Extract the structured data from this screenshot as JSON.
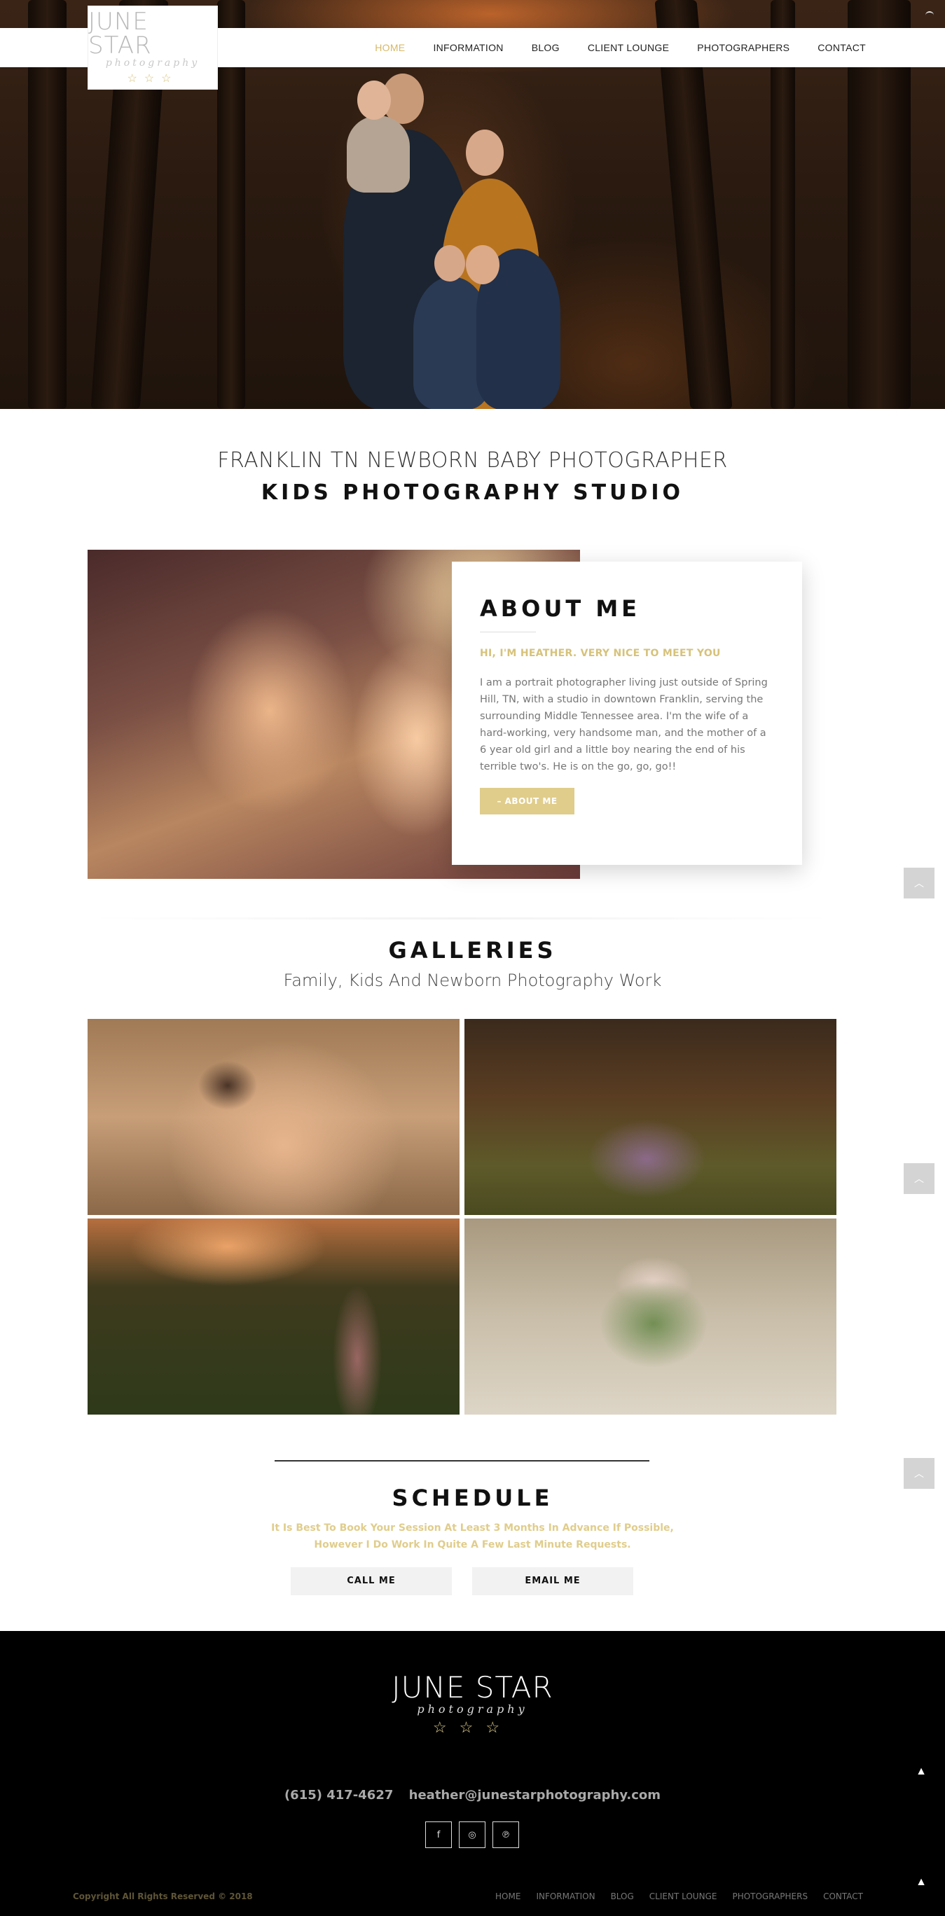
{
  "site": {
    "logo_main": "JUNE STAR",
    "logo_sub": "photography",
    "logo_stars": "☆☆☆"
  },
  "nav": {
    "items": [
      {
        "label": "HOME",
        "active": true
      },
      {
        "label": "INFORMATION"
      },
      {
        "label": "BLOG"
      },
      {
        "label": "CLIENT LOUNGE"
      },
      {
        "label": "PHOTOGRAPHERS"
      },
      {
        "label": "CONTACT"
      }
    ]
  },
  "intro": {
    "line1": "FRANKLIN TN NEWBORN BABY PHOTOGRAPHER",
    "line2": "KIDS PHOTOGRAPHY STUDIO"
  },
  "about": {
    "title": "ABOUT ME",
    "subtitle": "HI, I'M HEATHER. VERY NICE TO MEET YOU",
    "text": "I am a portrait photographer living just outside of Spring Hill, TN, with a studio in downtown Franklin, serving the surrounding Middle Tennessee area. I'm the wife of a hard-working, very handsome man, and the mother of a 6 year old girl and a little boy nearing the end of his terrible two's. He is on the go, go, go!!",
    "button": "– ABOUT ME"
  },
  "galleries": {
    "title": "GALLERIES",
    "subtitle": "Family, Kids And Newborn Photography Work"
  },
  "schedule": {
    "title": "SCHEDULE",
    "note_line1": "It Is Best To Book Your Session At Least 3 Months In Advance If Possible,",
    "note_line2": "However I Do Work In Quite A Few Last Minute Requests.",
    "call_button": "CALL ME",
    "email_button": "EMAIL ME"
  },
  "footer": {
    "logo_main": "JUNE STAR",
    "logo_sub": "photography",
    "logo_stars": "☆☆☆",
    "phone": "(615) 417-4627",
    "email": "heather@junestarphotography.com",
    "social": [
      "f",
      "◎",
      "℗"
    ],
    "copyright": "Copyright All Rights Reserved © 2018",
    "nav": [
      "HOME",
      "INFORMATION",
      "BLOG",
      "CLIENT LOUNGE",
      "PHOTOGRAPHERS",
      "CONTACT"
    ]
  },
  "ui": {
    "scroll_top_glyph": "︿",
    "footer_top_glyph": "▲"
  },
  "colors": {
    "accent": "#d6c27a",
    "footer_bg": "#000000"
  }
}
